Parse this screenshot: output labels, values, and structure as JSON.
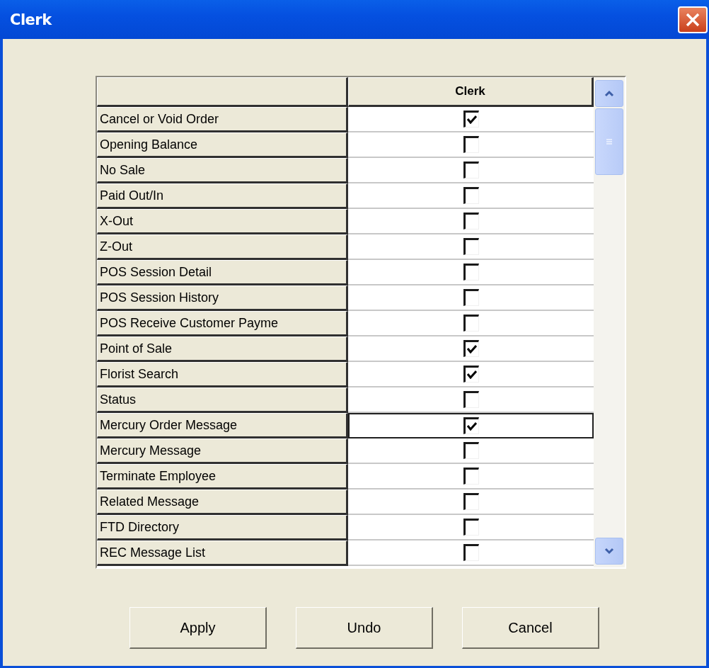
{
  "window": {
    "title": "Clerk"
  },
  "table": {
    "columns": [
      "",
      "Clerk"
    ],
    "rows": [
      {
        "label": "Cancel or Void Order",
        "checked": true,
        "selected": false
      },
      {
        "label": "Opening Balance",
        "checked": false,
        "selected": false
      },
      {
        "label": "No Sale",
        "checked": false,
        "selected": false
      },
      {
        "label": "Paid Out/In",
        "checked": false,
        "selected": false
      },
      {
        "label": "X-Out",
        "checked": false,
        "selected": false
      },
      {
        "label": "Z-Out",
        "checked": false,
        "selected": false
      },
      {
        "label": "POS Session Detail",
        "checked": false,
        "selected": false
      },
      {
        "label": "POS Session History",
        "checked": false,
        "selected": false
      },
      {
        "label": "POS Receive Customer Payme",
        "checked": false,
        "selected": false
      },
      {
        "label": "Point of Sale",
        "checked": true,
        "selected": false
      },
      {
        "label": "Florist Search",
        "checked": true,
        "selected": false
      },
      {
        "label": "Status",
        "checked": false,
        "selected": false
      },
      {
        "label": "Mercury Order Message",
        "checked": true,
        "selected": true
      },
      {
        "label": "Mercury Message",
        "checked": false,
        "selected": false
      },
      {
        "label": "Terminate Employee",
        "checked": false,
        "selected": false
      },
      {
        "label": "Related Message",
        "checked": false,
        "selected": false
      },
      {
        "label": "FTD Directory",
        "checked": false,
        "selected": false
      },
      {
        "label": "REC Message List",
        "checked": false,
        "selected": false
      }
    ]
  },
  "buttons": [
    "Apply",
    "Undo",
    "Cancel"
  ]
}
